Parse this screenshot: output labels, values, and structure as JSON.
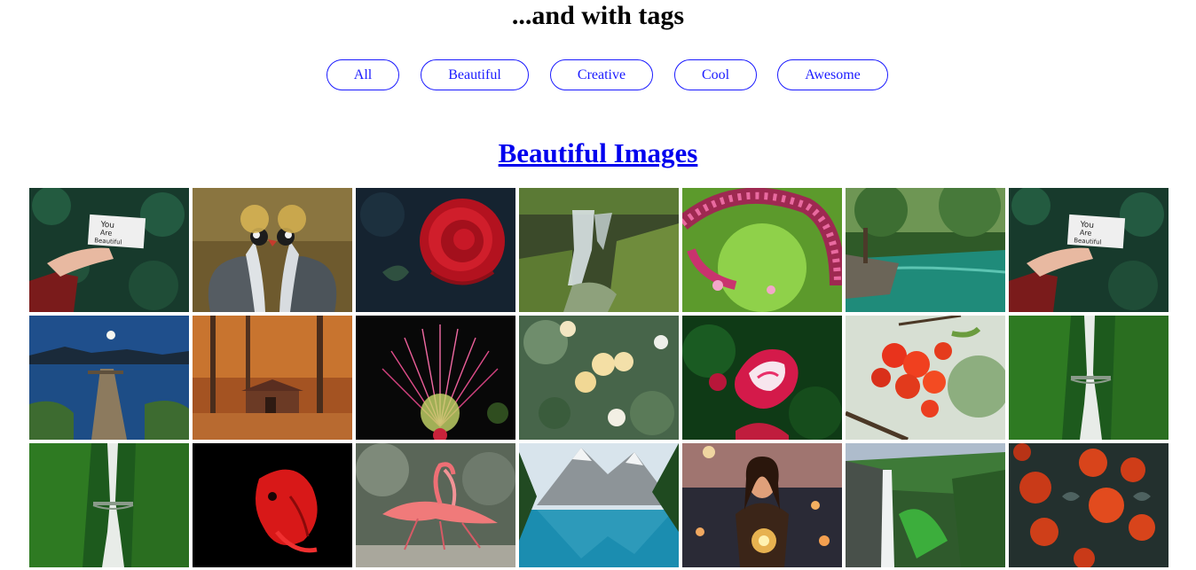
{
  "heading": "...and with tags",
  "tags": [
    {
      "label": "All",
      "name": "tag-all"
    },
    {
      "label": "Beautiful",
      "name": "tag-beautiful"
    },
    {
      "label": "Creative",
      "name": "tag-creative"
    },
    {
      "label": "Cool",
      "name": "tag-cool"
    },
    {
      "label": "Awesome",
      "name": "tag-awesome"
    }
  ],
  "section_title": "Beautiful Images",
  "card_note": {
    "line1": "You",
    "line2": "Are",
    "line3": "Beautiful"
  },
  "images": [
    [
      "note-in-hand",
      "crowned-cranes",
      "red-rose-dark",
      "waterfall-moss",
      "pink-blossoms",
      "forest-river",
      "note-in-hand"
    ],
    [
      "lake-pier-moon",
      "autumn-cabin",
      "pink-puff-flower",
      "white-roses",
      "pink-rose",
      "red-flame-flowers",
      "forest-waterfall"
    ],
    [
      "forest-waterfall",
      "red-betta-fish",
      "pink-flamingos",
      "mountain-lake",
      "girl-with-lights",
      "valley-waterfall",
      "red-roses-cluster"
    ]
  ],
  "colors": {
    "tag_accent": "#1a1aff",
    "link": "#0000ee"
  }
}
